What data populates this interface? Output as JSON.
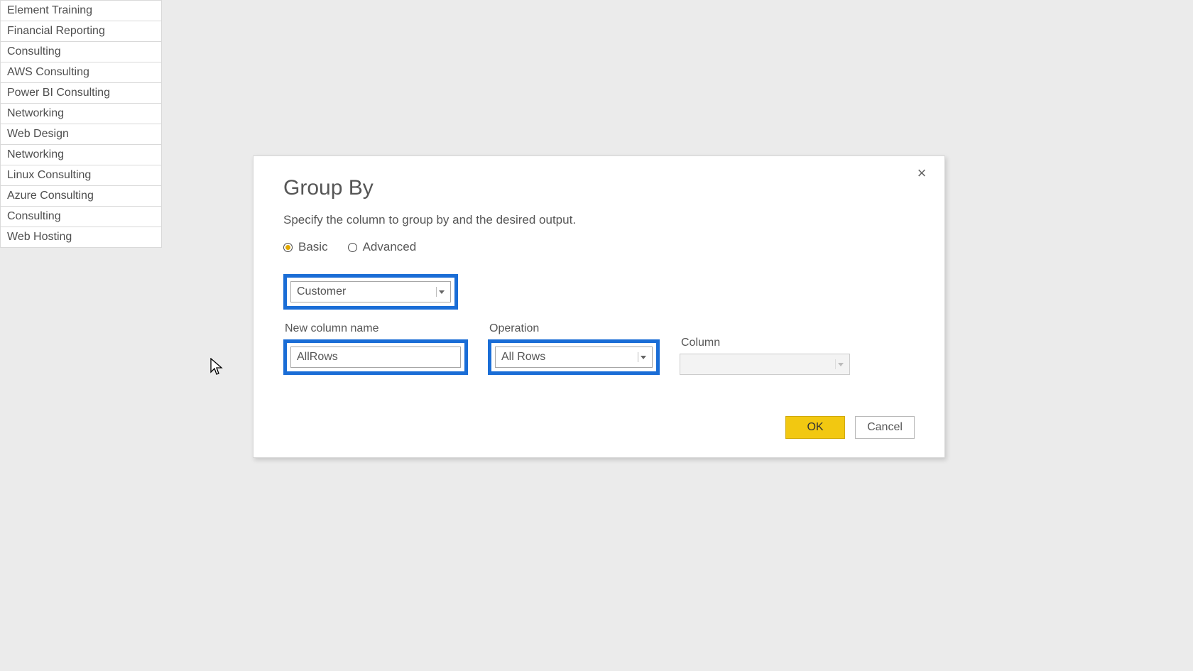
{
  "list": {
    "items": [
      "Element Training",
      "Financial Reporting",
      "Consulting",
      "AWS Consulting",
      "Power BI Consulting",
      "Networking",
      "Web Design",
      "Networking",
      "Linux Consulting",
      "Azure Consulting",
      "Consulting",
      "Web Hosting"
    ]
  },
  "dialog": {
    "title": "Group By",
    "subtitle": "Specify the column to group by and the desired output.",
    "radio": {
      "basic": "Basic",
      "advanced": "Advanced",
      "selected": "basic"
    },
    "groupby_value": "Customer",
    "new_column_label": "New column name",
    "new_column_value": "AllRows",
    "operation_label": "Operation",
    "operation_value": "All Rows",
    "column_label": "Column",
    "column_value": "",
    "ok": "OK",
    "cancel": "Cancel"
  }
}
